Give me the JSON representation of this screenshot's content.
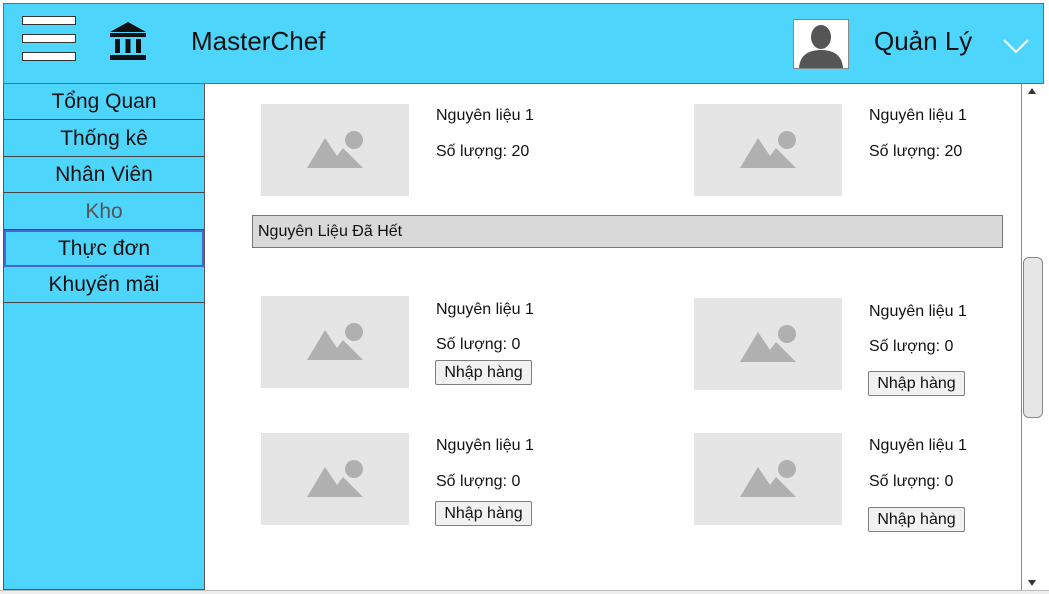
{
  "header": {
    "brand": "MasterChef",
    "user_name": "Quản Lý",
    "bg_color": "#4dd5fb",
    "icons": [
      "menu-icon",
      "bank-icon",
      "avatar-icon",
      "caret-down-icon"
    ]
  },
  "sidebar": {
    "items": [
      {
        "label": "Tổng Quan"
      },
      {
        "label": "Thống kê"
      },
      {
        "label": "Nhân Viên"
      },
      {
        "label": "Kho"
      },
      {
        "label": "Thực đơn"
      },
      {
        "label": "Khuyến mãi"
      }
    ]
  },
  "inventory": {
    "in_stock": [
      {
        "name": "Nguyên liệu 1",
        "qty": "Số lượng: 20"
      },
      {
        "name": "Nguyên liệu 1",
        "qty": "Số lượng: 20"
      }
    ],
    "out_of_stock_title": "Nguyên Liệu Đã Hết",
    "out_of_stock": [
      {
        "name": "Nguyên liệu 1",
        "qty": "Số lượng: 0",
        "button": "Nhập hàng"
      },
      {
        "name": "Nguyên liệu 1",
        "qty": "Số lượng: 0",
        "button": "Nhập hàng"
      },
      {
        "name": "Nguyên liệu 1",
        "qty": "Số lượng: 0",
        "button": "Nhập hàng"
      },
      {
        "name": "Nguyên liệu 1",
        "qty": "Số lượng: 0",
        "button": "Nhập hàng"
      }
    ]
  }
}
